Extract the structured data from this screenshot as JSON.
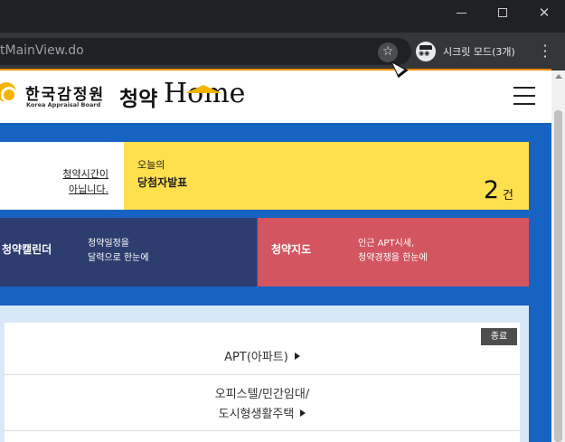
{
  "browser": {
    "url_fragment": "tMainView.do",
    "incognito_label": "시크릿 모드(3개)"
  },
  "header": {
    "org_name_ko": "한국감정원",
    "org_name_en": "Korea Appraisal Board",
    "brand_prefix": "청약",
    "brand_suffix": "Home"
  },
  "notice": {
    "line1": "청약시간이",
    "line2": "아닙니다."
  },
  "winner": {
    "line1": "오늘의",
    "line2": "당첨자발표",
    "count": "2",
    "unit": "건"
  },
  "calendar": {
    "title": "청약캘린더",
    "desc1": "청약일정을",
    "desc2": "달력으로 한눈에"
  },
  "map": {
    "title": "청약지도",
    "desc1": "인근 APT시세,",
    "desc2": "청약경쟁을 한눈에"
  },
  "list": {
    "badge": "종료",
    "apt_label": "APT(아파트)",
    "officetel_line1": "오피스텔/민간임대/",
    "officetel_line2": "도시형생활주택"
  },
  "colors": {
    "page_blue": "#1663c2",
    "yellow": "#fedf4d",
    "navy": "#2d3d6f",
    "red": "#d35560",
    "accent": "#f28b00"
  }
}
